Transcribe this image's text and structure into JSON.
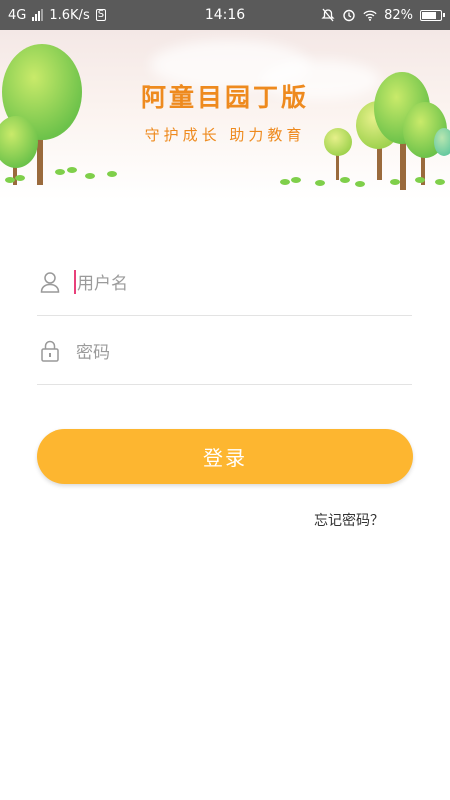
{
  "status_bar": {
    "network": "4G",
    "speed": "1.6K/s",
    "speed_icon_label": "S",
    "time": "14:16",
    "battery": "82%",
    "battery_level": 0.82
  },
  "banner": {
    "title": "阿童目园丁版",
    "subtitle": "守护成长  助力教育"
  },
  "form": {
    "username_placeholder": "用户名",
    "password_placeholder": "密码",
    "login_label": "登录",
    "forgot_label": "忘记密码？"
  },
  "colors": {
    "accent": "#fdb630",
    "title": "#ee8a1e",
    "cursor": "#e8407a"
  },
  "icons": [
    "signal-icon",
    "mute-icon",
    "alarm-icon",
    "wifi-icon",
    "battery-icon",
    "user-icon",
    "lock-icon"
  ]
}
